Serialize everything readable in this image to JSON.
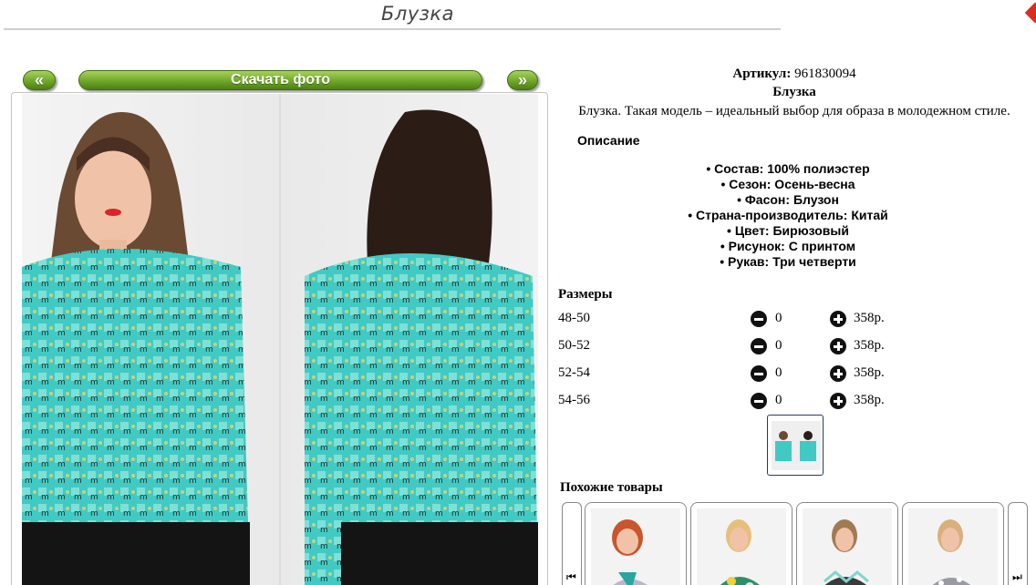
{
  "page": {
    "title": "Блузка"
  },
  "gallery": {
    "prev_label": "«",
    "next_label": "»",
    "download_label": "Скачать фото"
  },
  "product": {
    "sku_label": "Артикул:",
    "sku_value": "961830094",
    "name": "Блузка",
    "description": "Блузка. Такая модель – идеальный выбор для образа в молодежном стиле.",
    "description_heading": "Описание",
    "attributes": [
      "Состав: 100% полиэстер",
      "Сезон: Осень-весна",
      "Фасон: Блузон",
      "Страна-производитель: Китай",
      "Цвет: Бирюзовый",
      "Рисунок: С принтом",
      "Рукав: Три четверти"
    ]
  },
  "sizes": {
    "heading": "Размеры",
    "rows": [
      {
        "size": "48-50",
        "qty": "0",
        "price": "358р."
      },
      {
        "size": "50-52",
        "qty": "0",
        "price": "358р."
      },
      {
        "size": "52-54",
        "qty": "0",
        "price": "358р."
      },
      {
        "size": "54-56",
        "qty": "0",
        "price": "358р."
      }
    ]
  },
  "similar": {
    "heading": "Похожие товары",
    "left_arrow": "⏮",
    "right_arrow": "⏭"
  },
  "colors": {
    "button_green": "#6fa62a",
    "blouse_turquoise": "#3cc9c4",
    "close_red": "#d83020"
  }
}
